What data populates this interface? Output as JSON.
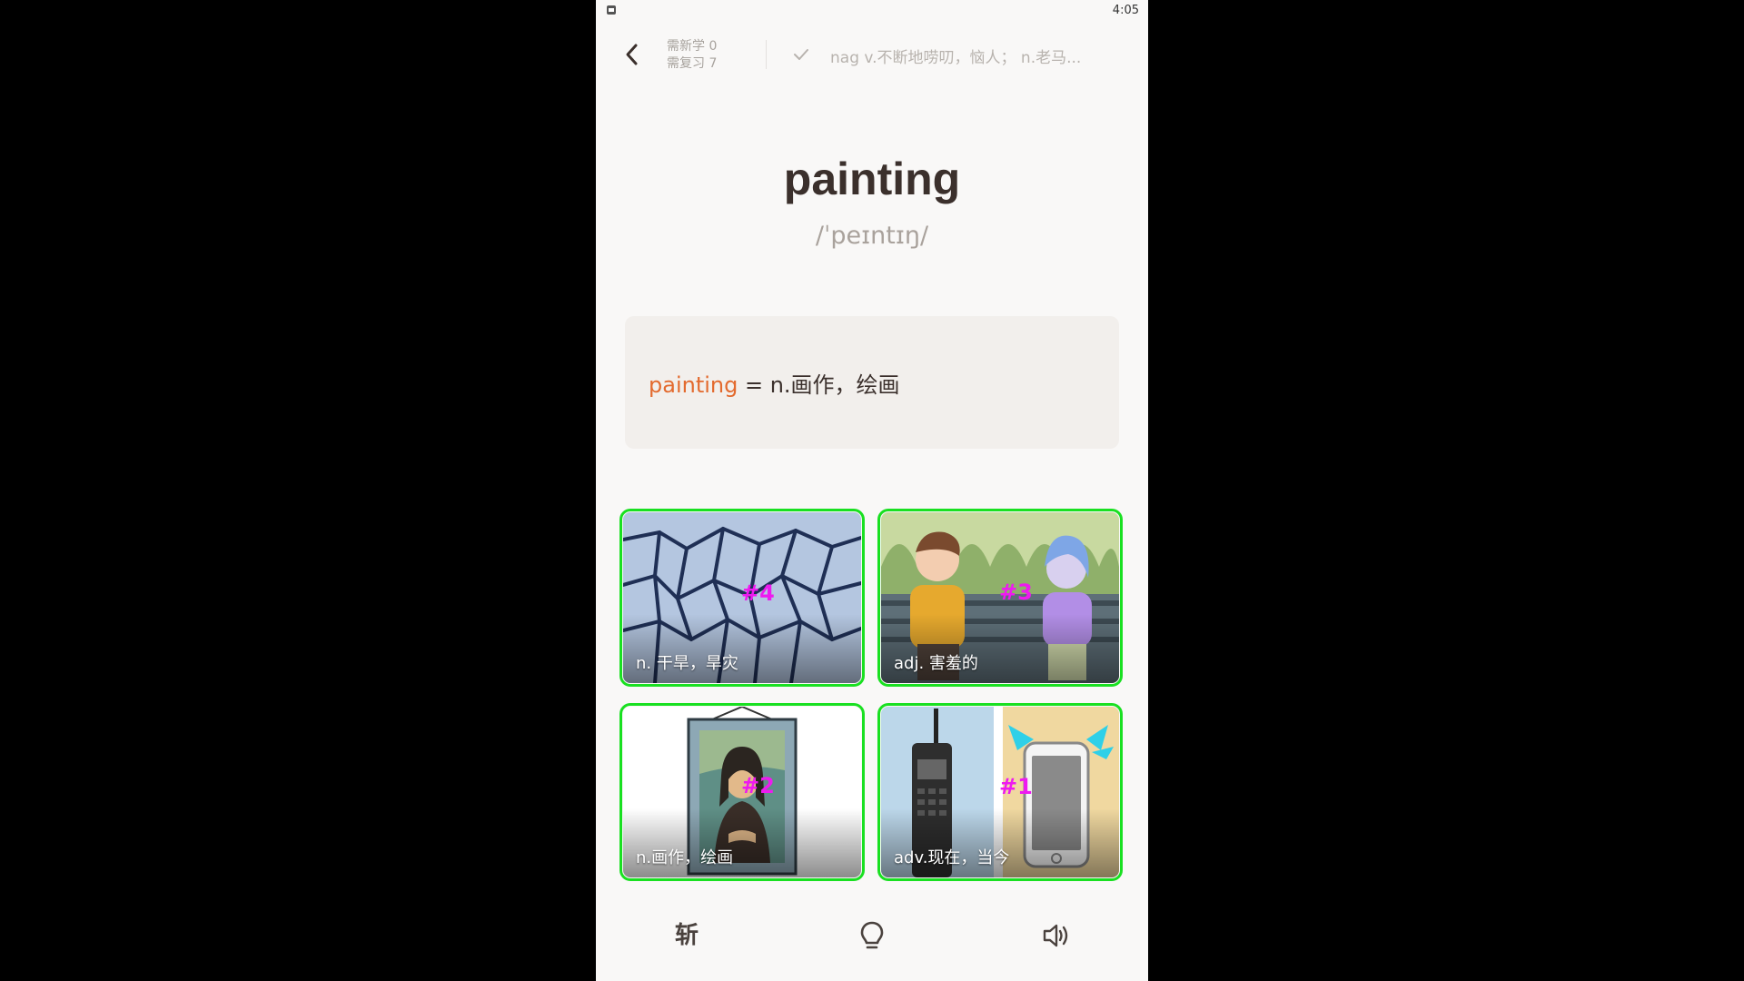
{
  "status_bar": {
    "time": "4:05"
  },
  "header": {
    "new_count": "需新学 0",
    "review_count": "需复习 7",
    "previous_word": "nag v.不断地唠叨，恼人； n.老马..."
  },
  "word": {
    "text": "painting",
    "phonetic": "/ˈpeɪntɪŋ/"
  },
  "definition": {
    "word": "painting",
    "equals": " = ",
    "meaning": "n.画作，绘画"
  },
  "options": [
    {
      "label": "n. 干旱，旱灾",
      "marker": "#4",
      "image": "cracked-earth"
    },
    {
      "label": "adj. 害羞的",
      "marker": "#3",
      "image": "shy-couple-bench"
    },
    {
      "label": "n.画作，绘画",
      "marker": "#2",
      "image": "framed-portrait"
    },
    {
      "label": "adv.现在，当今",
      "marker": "#1",
      "image": "old-vs-new-phone"
    }
  ],
  "bottom_bar": {
    "slash_label": "斩",
    "hint_icon": "lightbulb-icon",
    "sound_icon": "speaker-icon"
  },
  "colors": {
    "accent": "#e36a2e",
    "marker": "#ee1af0",
    "outline": "#19e021",
    "background": "#f9f8f7",
    "card": "#f2efec"
  }
}
